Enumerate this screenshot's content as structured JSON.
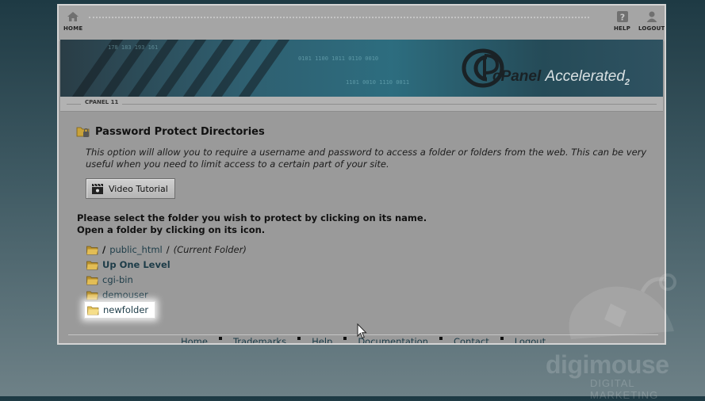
{
  "topbar": {
    "home_label": "HOME",
    "help_label": "HELP",
    "logout_label": "LOGOUT",
    "home_icon": "home-icon",
    "help_icon": "help-icon",
    "logout_icon": "user-icon"
  },
  "banner": {
    "brand_text": "cPanel",
    "brand_accent": "Accelerated",
    "brand_version": "2",
    "bits_1": "178  183  193  161",
    "bits_2": "0101 1100 1011 0110 0010",
    "bits_3": "1101 0010 1110 0011"
  },
  "version_tab": "CPANEL 11",
  "main": {
    "title": "Password Protect Directories",
    "description": "This option will allow you to require a username and password to access a folder or folders from the web. This can be very useful when you need to limit access to a certain part of your site.",
    "video_button": "Video Tutorial",
    "instruction_1": "Please select the folder you wish to protect by clicking on its name.",
    "instruction_2": "Open a folder by clicking on its icon.",
    "path": {
      "root": "/",
      "folder": "public_html",
      "separator": "/",
      "current": "(Current Folder)"
    },
    "up_level": "Up One Level",
    "folders": [
      "cgi-bin",
      "demouser",
      "newfolder"
    ]
  },
  "footer": {
    "links": [
      "Home",
      "Trademarks",
      "Help",
      "Documentation",
      "Contact",
      "Logout"
    ]
  },
  "watermark": {
    "name": "digimouse",
    "tagline": "DIGITAL MARKETING"
  },
  "colors": {
    "link": "#1d3c48",
    "panel_bg": "#9a9a9a",
    "highlight": "#ffffff"
  }
}
